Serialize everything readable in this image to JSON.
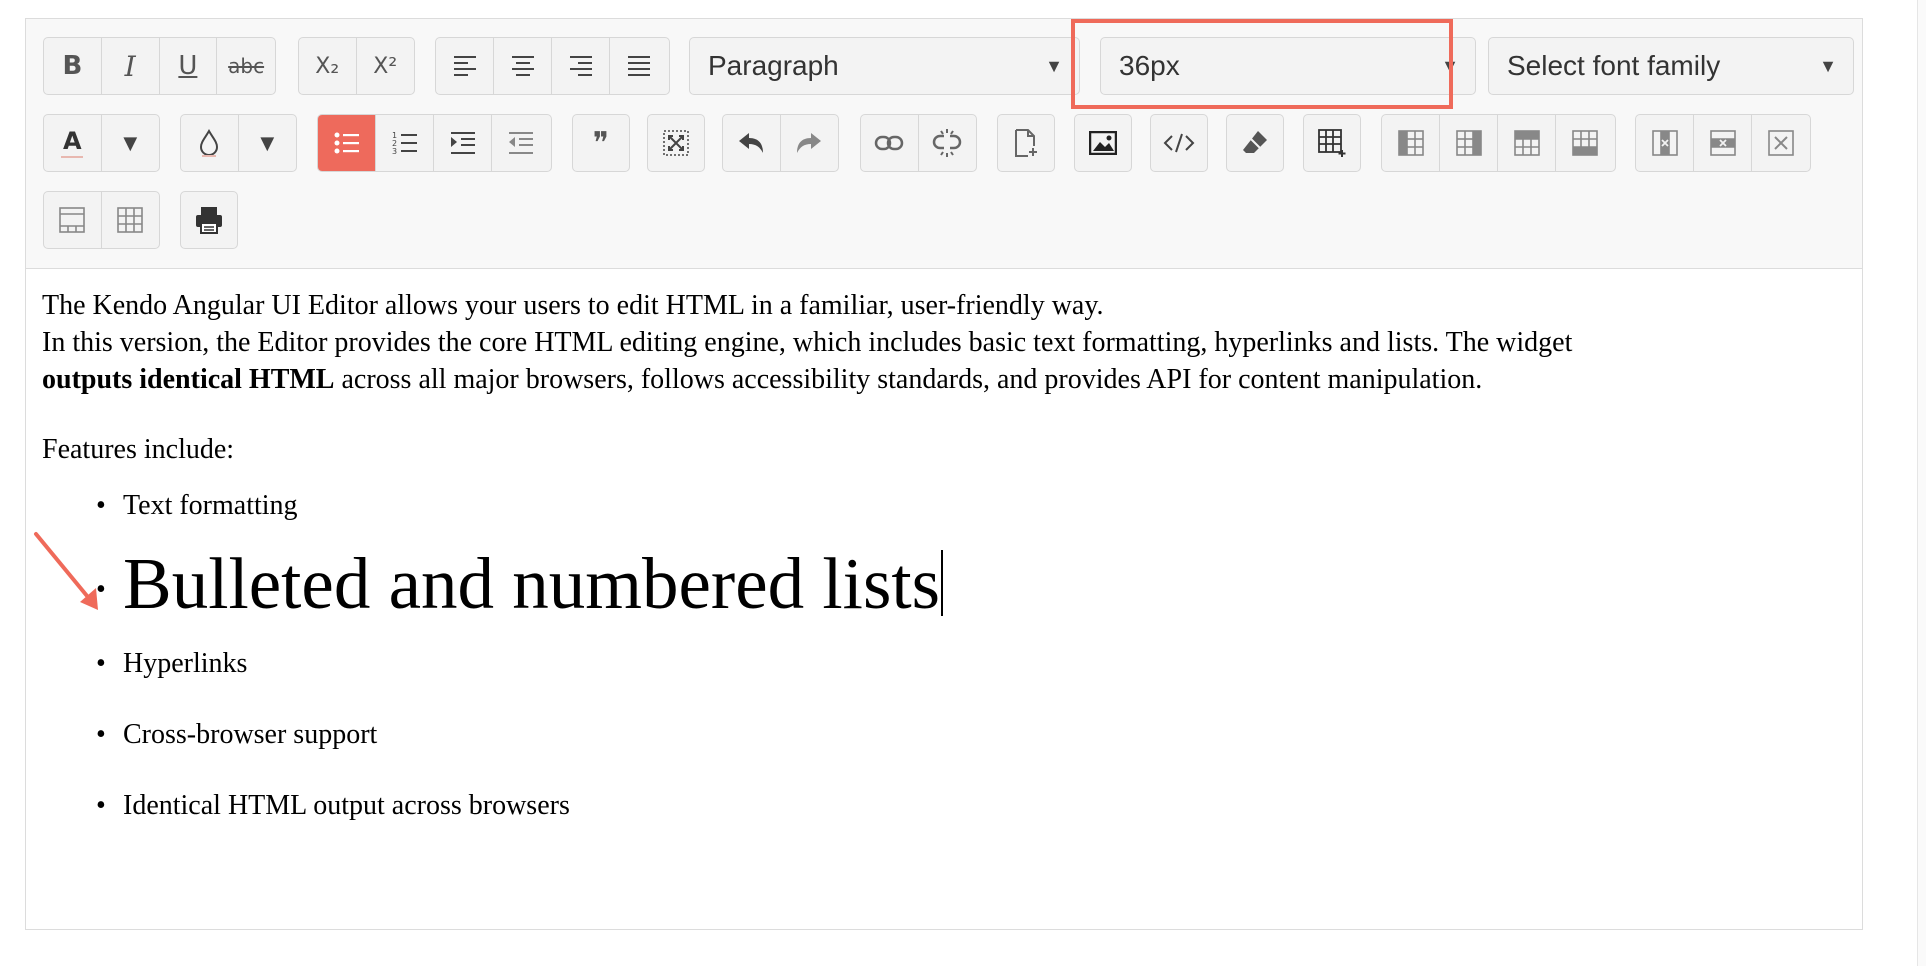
{
  "toolbar": {
    "format_block": {
      "value": "Paragraph"
    },
    "font_size": {
      "value": "36px"
    },
    "font_family": {
      "placeholder": "Select font family"
    },
    "bold_label": "B",
    "italic_label": "I",
    "underline_label": "U",
    "strike_label": "abc",
    "subscript_label": "X₂",
    "superscript_label": "X²",
    "text_color_label": "A",
    "blockquote_label": "❞"
  },
  "content": {
    "intro_line1": "The Kendo Angular UI Editor allows your users to edit HTML in a familiar, user-friendly way.",
    "intro_line2_a": "In this version, the Editor provides the core HTML editing engine, which includes basic text formatting, hyperlinks and lists. The widget",
    "intro_bold": "outputs identical HTML",
    "intro_line2_b": " across all major browsers, follows accessibility standards, and provides API for content manipulation.",
    "features_heading": "Features include:",
    "features": [
      "Text formatting",
      "Bulleted and numbered lists",
      "Hyperlinks",
      "Cross-browser support",
      "Identical HTML output across browsers"
    ]
  },
  "colors": {
    "highlight": "#ef6a5a",
    "active_button": "#ee6a5c"
  }
}
